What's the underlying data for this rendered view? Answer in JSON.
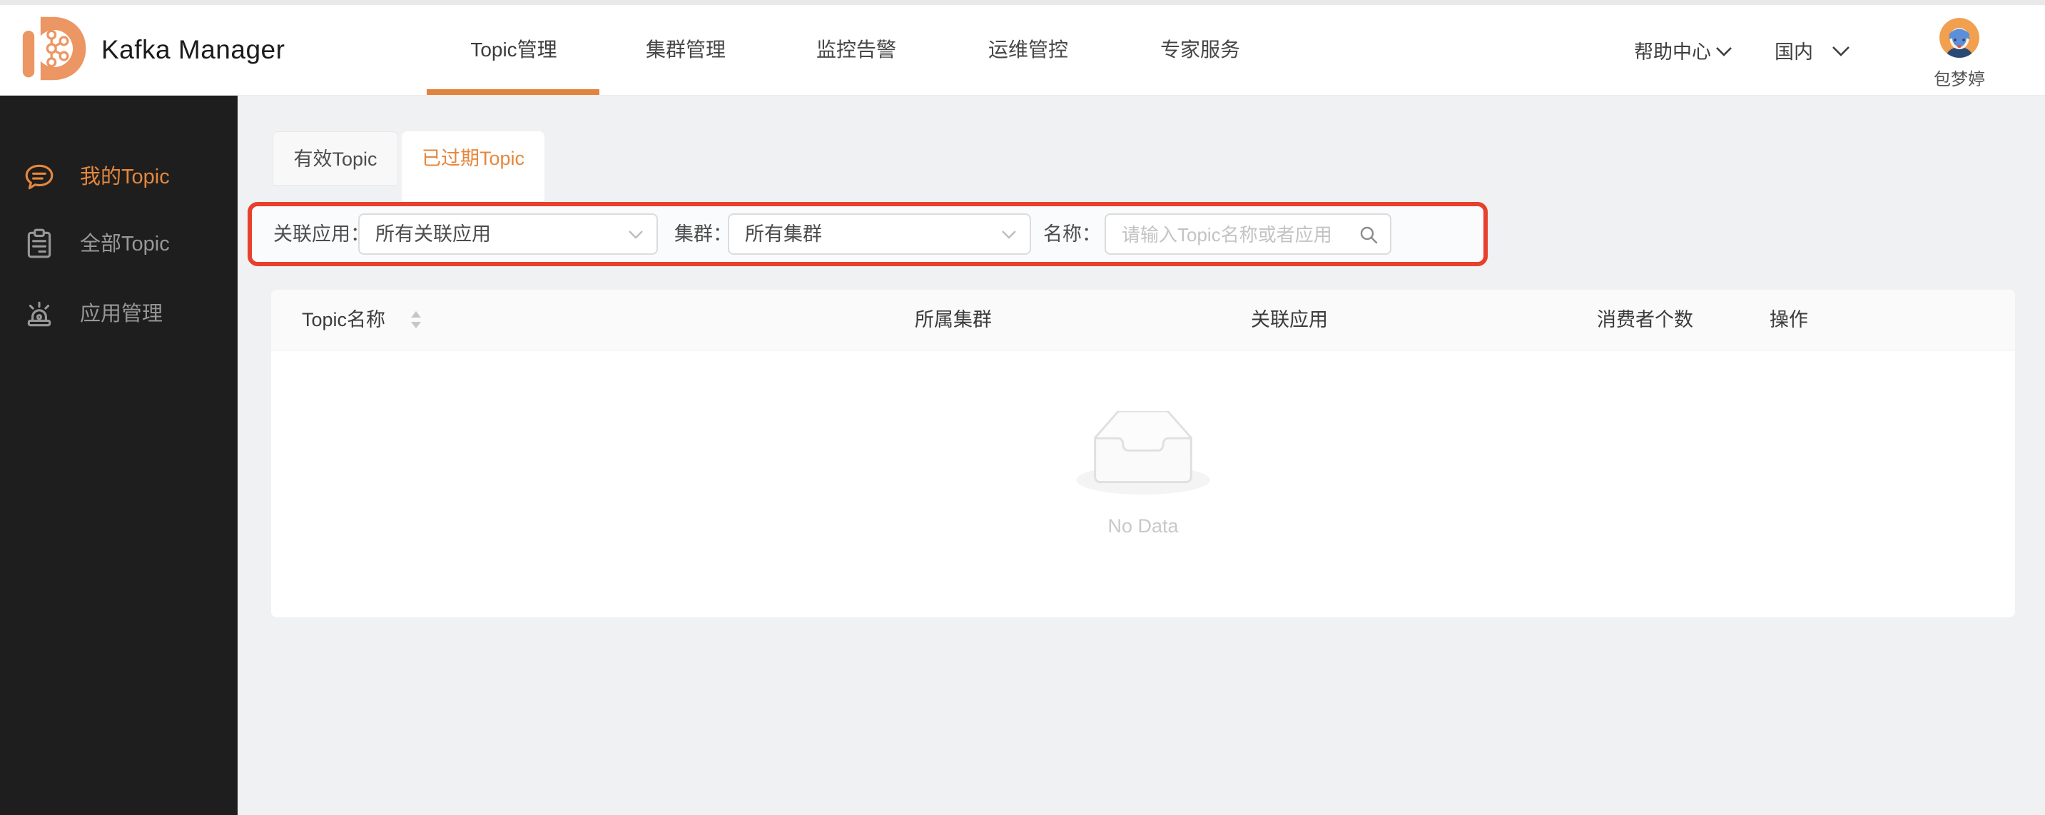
{
  "header": {
    "brand": "Kafka Manager",
    "nav": [
      {
        "label": "Topic管理",
        "active": true
      },
      {
        "label": "集群管理",
        "active": false
      },
      {
        "label": "监控告警",
        "active": false
      },
      {
        "label": "运维管控",
        "active": false
      },
      {
        "label": "专家服务",
        "active": false
      }
    ],
    "help_label": "帮助中心",
    "region_label": "国内",
    "user_name": "包梦婷"
  },
  "sidebar": {
    "items": [
      {
        "label": "我的Topic",
        "icon": "chat-bubble-icon",
        "active": true
      },
      {
        "label": "全部Topic",
        "icon": "clipboard-icon",
        "active": false
      },
      {
        "label": "应用管理",
        "icon": "siren-icon",
        "active": false
      }
    ]
  },
  "tabs": [
    {
      "label": "有效Topic",
      "active": false
    },
    {
      "label": "已过期Topic",
      "active": true
    }
  ],
  "filters": {
    "app_label": "关联应用：",
    "app_value": "所有关联应用",
    "cluster_label": "集群：",
    "cluster_value": "所有集群",
    "name_label": "名称：",
    "name_placeholder": "请输入Topic名称或者应用",
    "search_icon": "magnifier",
    "dropdown_icon": "chevron-down"
  },
  "table": {
    "columns": [
      "Topic名称",
      "所属集群",
      "关联应用",
      "消费者个数",
      "操作"
    ],
    "rows": [],
    "empty_text": "No Data"
  },
  "colors": {
    "accent_orange": "#e5873c",
    "underline_orange": "#e28440",
    "logo_orange": "#ec9663",
    "annotation_red": "#e7402c",
    "sidebar_bg": "#1e1e1e",
    "page_bg": "#f0f1f3",
    "avatar_bg": "#f0a04e"
  }
}
